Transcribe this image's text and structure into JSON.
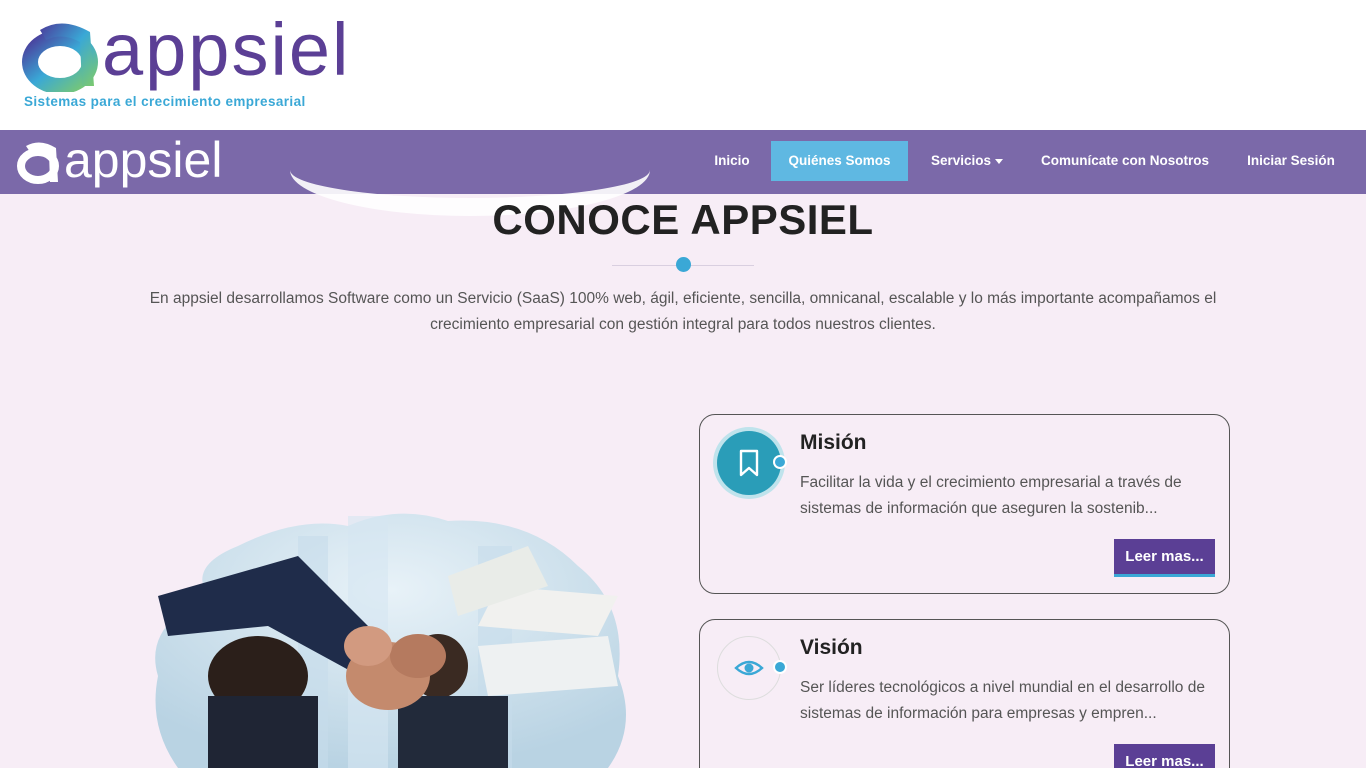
{
  "brand": {
    "name": "appsiel",
    "tagline": "Sistemas para el crecimiento empresarial"
  },
  "nav": {
    "brand": "appsiel",
    "items": [
      {
        "label": "Inicio"
      },
      {
        "label": "Quiénes Somos",
        "active": true
      },
      {
        "label": "Servicios"
      },
      {
        "label": "Comunícate con Nosotros"
      },
      {
        "label": "Iniciar Sesión"
      }
    ]
  },
  "main": {
    "title": "CONOCE APPSIEL",
    "intro": "En appsiel desarrollamos Software como un Servicio (SaaS) 100% web, ágil, eficiente, sencilla, omnicanal, escalable y lo más importante acompañamos el crecimiento empresarial con gestión integral para todos nuestros clientes.",
    "cards": [
      {
        "icon": "bookmark-icon",
        "title": "Misión",
        "text": "Facilitar la vida y el crecimiento empresarial a través de sistemas de información que aseguren la sostenib...",
        "button": "Leer mas..."
      },
      {
        "icon": "eye-icon",
        "title": "Visión",
        "text": "Ser líderes tecnológicos a nivel mundial en el desarrollo de sistemas de información para empresas y empren...",
        "button": "Leer mas..."
      }
    ]
  },
  "colors": {
    "brand_purple": "#5b3f95",
    "navbar": "#7b69a9",
    "accent_blue": "#3aa8d6",
    "active_nav": "#5fb8e2",
    "page_bg": "#f7edf6"
  }
}
